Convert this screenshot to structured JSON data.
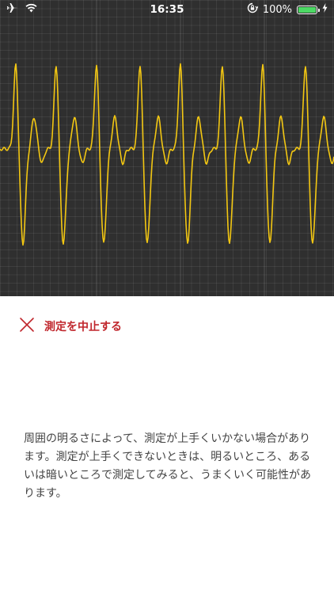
{
  "status_bar": {
    "time": "16:35",
    "battery_percent": "100%",
    "battery_level": 1.0,
    "icons": [
      "airplane-icon",
      "wifi-icon",
      "orientation-lock-icon",
      "charging-icon"
    ]
  },
  "graph": {
    "line_color": "#f3c712",
    "background": "#2f2f2f"
  },
  "stop": {
    "label": "測定を中止する",
    "icon": "close-icon",
    "color": "#c0262c"
  },
  "notice": {
    "text": "周囲の明るさによって、測定が上手くいかない場合があります。測定が上手くできないときは、明るいところ、あるいは暗いところで測定してみると、うまくいく可能性があります。"
  }
}
